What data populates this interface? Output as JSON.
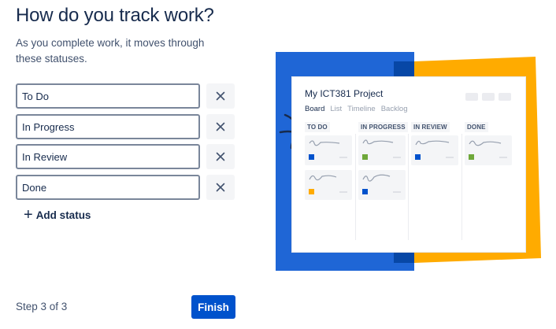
{
  "title": "How do you track work?",
  "subtitle": "As you complete work, it moves through these statuses.",
  "statuses": [
    "To Do",
    "In Progress",
    "In Review",
    "Done"
  ],
  "remove_icon": "close-icon",
  "add_status": {
    "icon": "plus-icon",
    "label": "Add status"
  },
  "footer": {
    "step": "Step 3 of 3",
    "finish": "Finish"
  },
  "illustration": {
    "project_title": "My ICT381 Project",
    "tabs": [
      "Board",
      "List",
      "Timeline",
      "Backlog"
    ],
    "active_tab": "Board",
    "columns": [
      "TO DO",
      "IN PROGRESS",
      "IN REVIEW",
      "DONE"
    ],
    "colors": {
      "blue_panel": "#1f66d6",
      "yellow_panel": "#ffab00",
      "dark_blue": "#0747a6",
      "card_blue": "#0052cc",
      "card_green": "#6fa83a",
      "card_orange": "#ffab00"
    }
  },
  "colors": {
    "primary": "#0052cc",
    "text": "#172b4d",
    "subtle": "#42526e"
  }
}
